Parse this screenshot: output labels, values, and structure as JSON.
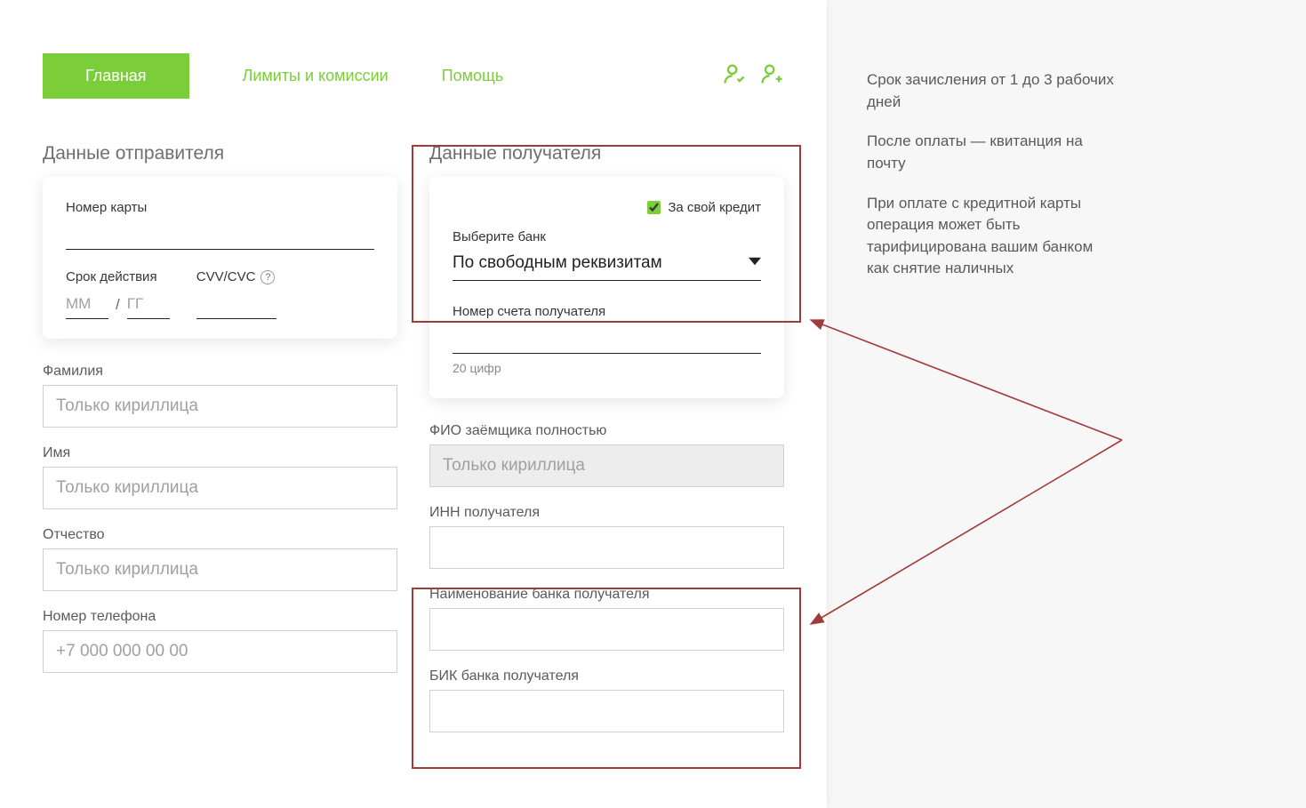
{
  "nav": {
    "main": "Главная",
    "limits": "Лимиты и комиссии",
    "help": "Помощь"
  },
  "sender": {
    "title": "Данные отправителя",
    "card_number_label": "Номер карты",
    "expiry_label": "Срок действия",
    "mm_placeholder": "ММ",
    "yy_placeholder": "ГГ",
    "cvc_label": "CVV/CVC",
    "surname_label": "Фамилия",
    "name_label": "Имя",
    "patronymic_label": "Отчество",
    "cyrillic_placeholder": "Только кириллица",
    "phone_label": "Номер телефона",
    "phone_placeholder": "+7 000 000 00 00"
  },
  "recipient": {
    "title": "Данные получателя",
    "own_credit_label": "За свой кредит",
    "bank_select_label": "Выберите банк",
    "bank_select_value": "По свободным реквизитам",
    "account_label": "Номер счета получателя",
    "account_hint": "20 цифр",
    "fio_label": "ФИО заёмщика полностью",
    "fio_placeholder": "Только кириллица",
    "inn_label": "ИНН получателя",
    "bank_name_label": "Наименование банка получателя",
    "bik_label": "БИК банка получателя"
  },
  "side": {
    "p1": "Срок зачисления от 1 до 3 рабочих дней",
    "p2": "После оплаты — квитанция на почту",
    "p3": "При оплате с кредитной карты операция может быть тарифицирована вашим банком как снятие наличных"
  }
}
